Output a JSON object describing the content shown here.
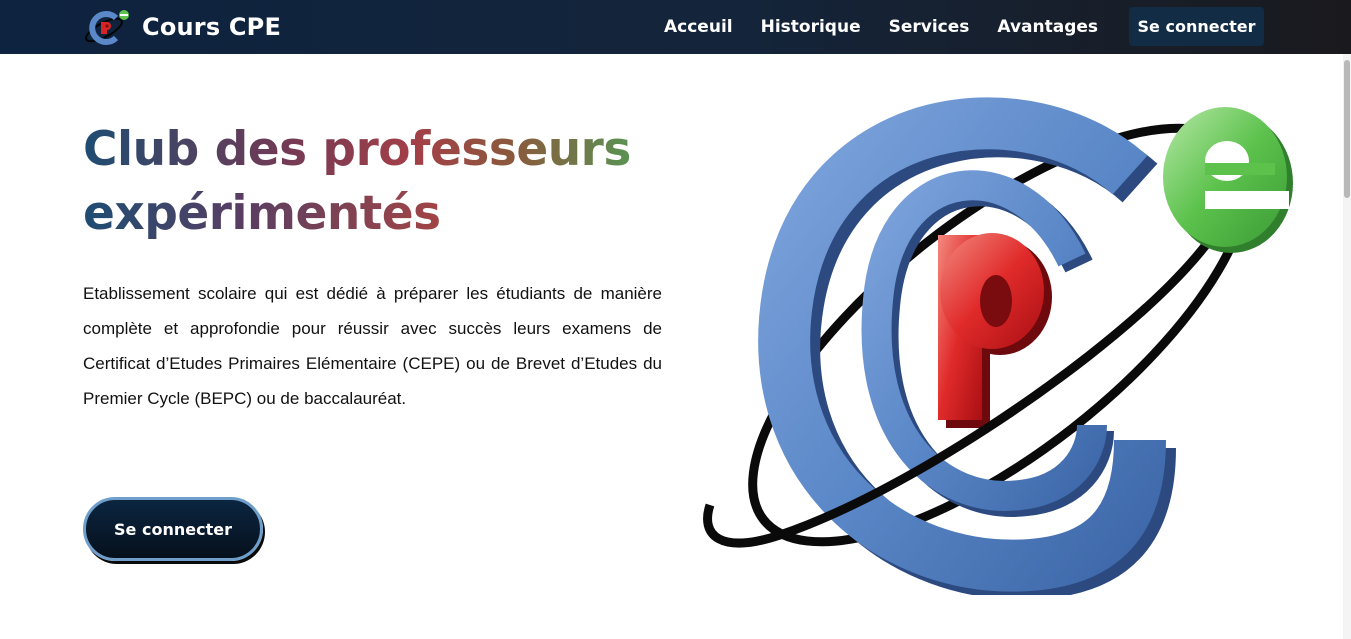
{
  "navbar": {
    "brand": {
      "logo_icon": "cpe-logo-icon",
      "title": "Cours CPE"
    },
    "links": [
      {
        "label": "Acceuil"
      },
      {
        "label": "Historique"
      },
      {
        "label": "Services"
      },
      {
        "label": "Avantages"
      }
    ],
    "login_label": "Se connecter"
  },
  "hero": {
    "title_line1": "Club des professeurs",
    "title_line2": "expérimentés",
    "description": "Etablissement scolaire qui est dédié à préparer les étudiants de manière complète et approfondie pour réussir avec succès leurs examens de Certificat d’Etudes Primaires Elémentaire (CEPE) ou de Brevet d’Etudes du Premier Cycle (BEPC) ou de baccalauréat.",
    "cta_label": "Se connecter",
    "logo_letters": {
      "c": "C",
      "p": "P",
      "e": "e"
    }
  },
  "colors": {
    "navbar_bg": "#14243a",
    "cta_bg": "#0b2540",
    "cta_border": "#6e9ec9",
    "logo_blue": "#5b88c8",
    "logo_red": "#d92424",
    "logo_green": "#5cc24c"
  }
}
